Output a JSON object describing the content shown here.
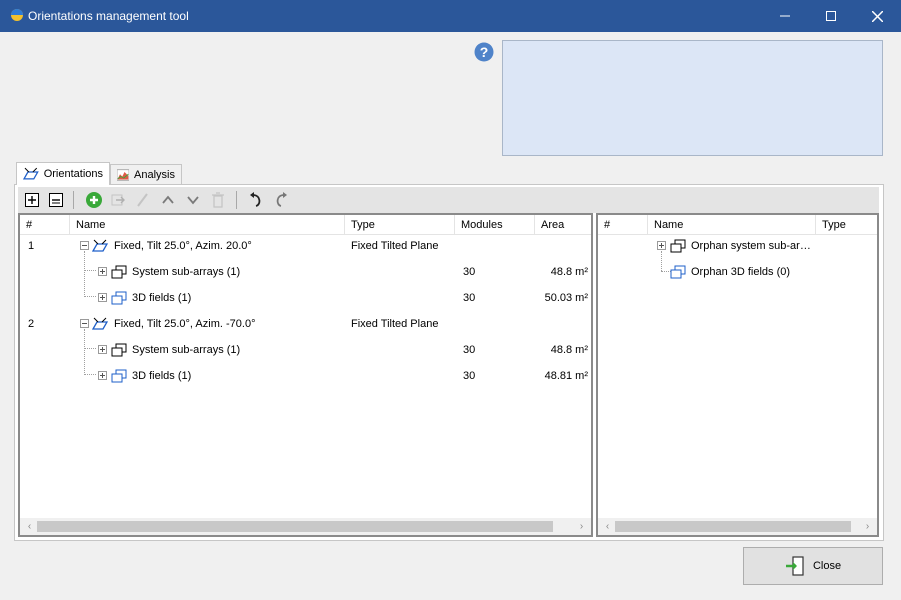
{
  "window": {
    "title": "Orientations management tool"
  },
  "tabs": [
    {
      "label": "Orientations",
      "icon": "orientation-icon"
    },
    {
      "label": "Analysis",
      "icon": "chart-icon"
    }
  ],
  "toolbar": {
    "buttons": [
      "expand-all-icon",
      "collapse-all-icon",
      "add-icon",
      "move-icon",
      "edit-icon",
      "up-icon",
      "down-icon",
      "delete-icon",
      "undo-icon",
      "redo-icon"
    ]
  },
  "left_grid": {
    "columns": [
      "#",
      "Name",
      "Type",
      "Modules",
      "Area"
    ],
    "rows": [
      {
        "num": "1",
        "name": "Fixed, Tilt 25.0°, Azim. 20.0°",
        "type": "Fixed Tilted Plane",
        "modules": "",
        "area": ""
      },
      {
        "num": "",
        "name": "System sub-arrays (1)",
        "type": "",
        "modules": "30",
        "area": "48.8 m²"
      },
      {
        "num": "",
        "name": "3D fields (1)",
        "type": "",
        "modules": "30",
        "area": "50.03 m²"
      },
      {
        "num": "2",
        "name": "Fixed, Tilt 25.0°, Azim. -70.0°",
        "type": "Fixed Tilted Plane",
        "modules": "",
        "area": ""
      },
      {
        "num": "",
        "name": "System sub-arrays (1)",
        "type": "",
        "modules": "30",
        "area": "48.8 m²"
      },
      {
        "num": "",
        "name": "3D fields (1)",
        "type": "",
        "modules": "30",
        "area": "48.81 m²"
      }
    ]
  },
  "right_grid": {
    "columns": [
      "#",
      "Name",
      "Type"
    ],
    "rows": [
      {
        "name": "Orphan system sub-ar…"
      },
      {
        "name": "Orphan 3D fields (0)"
      }
    ]
  },
  "close_button": {
    "label": "Close"
  },
  "colors": {
    "titlebar": "#2b579a",
    "info_panel": "#dce6f6",
    "accent_blue": "#1e5fc9",
    "add_green": "#3aa93a"
  }
}
